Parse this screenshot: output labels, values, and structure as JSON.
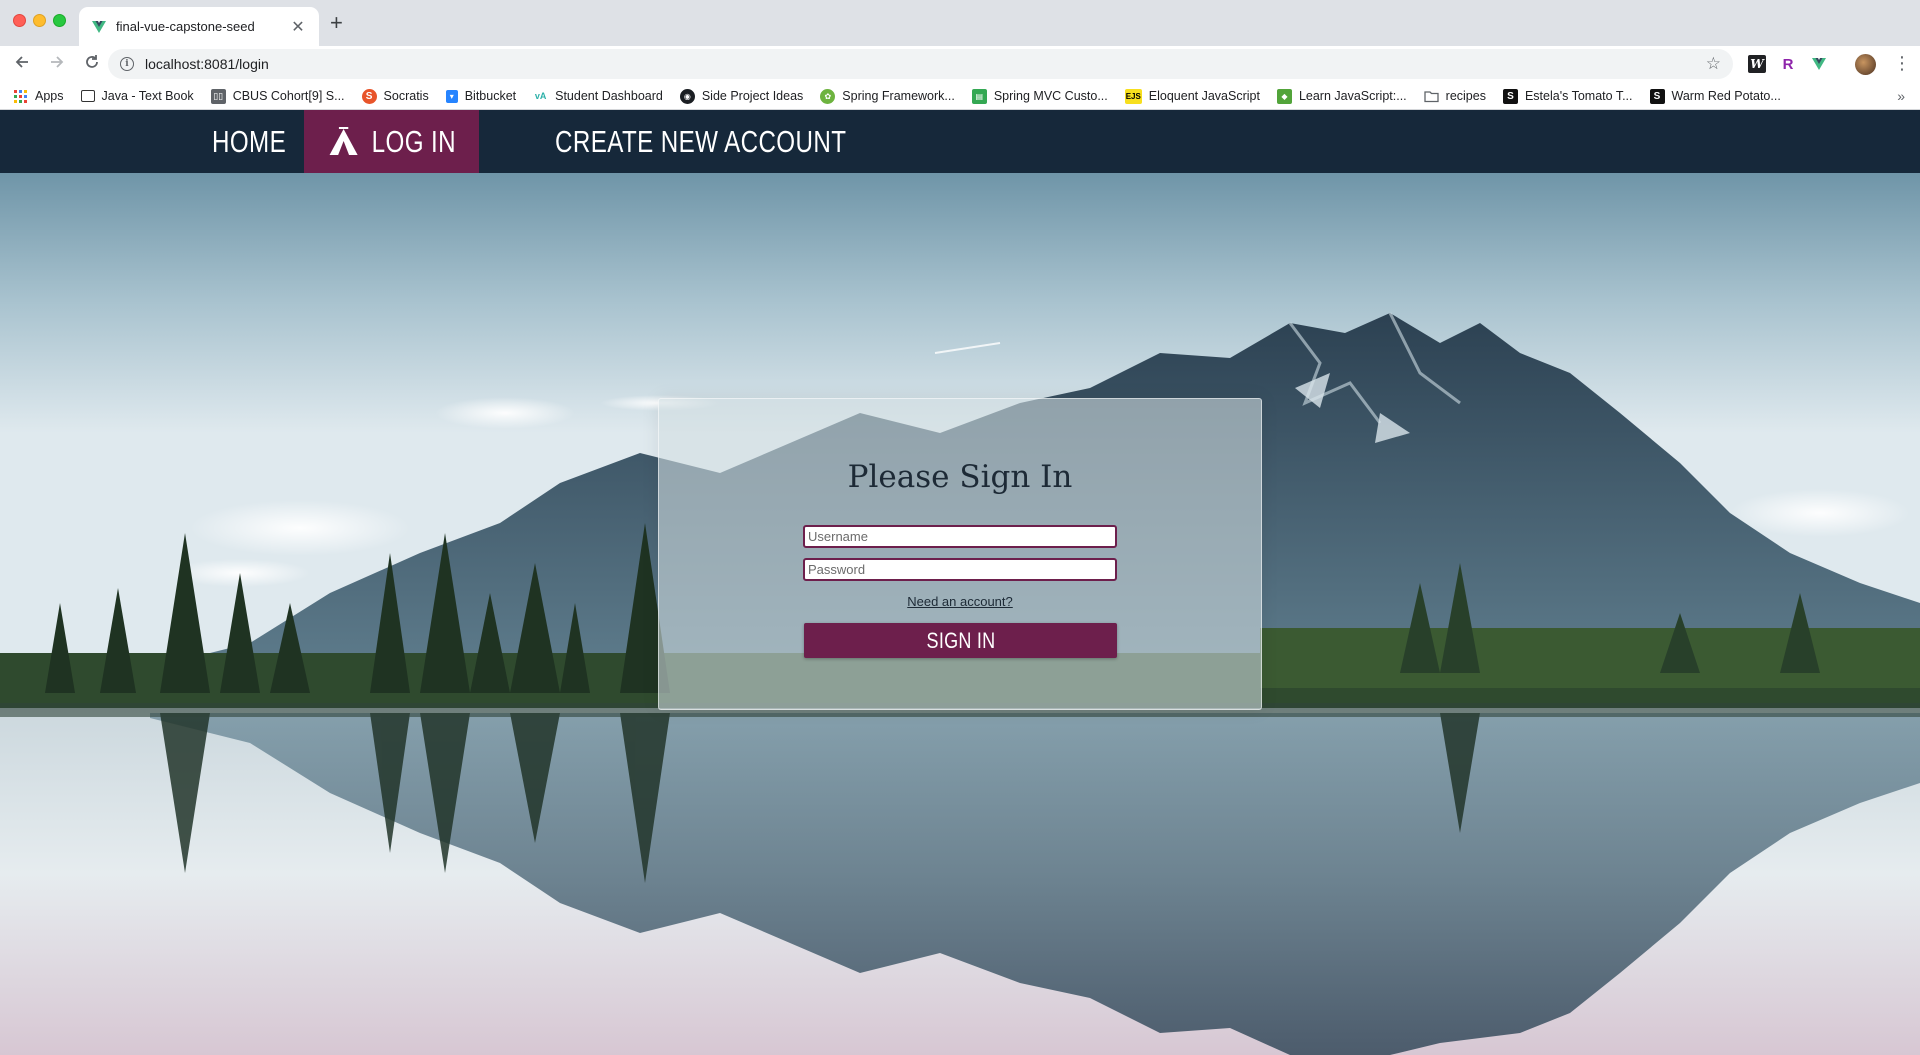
{
  "browser": {
    "tab_title": "final-vue-capstone-seed",
    "tab_close": "✕",
    "new_tab": "+",
    "url": "localhost:8081/login",
    "info_glyph": "i",
    "bookmarks": [
      {
        "label": "Apps",
        "icon": "apps-grid-icon"
      },
      {
        "label": "Java - Text Book",
        "icon": "book-icon"
      },
      {
        "label": "CBUS Cohort[9] S...",
        "icon": "trello-icon"
      },
      {
        "label": "Socratis",
        "icon": "socratis-icon"
      },
      {
        "label": "Bitbucket",
        "icon": "bitbucket-icon"
      },
      {
        "label": "Student Dashboard",
        "icon": "techelevator-icon"
      },
      {
        "label": "Side Project Ideas",
        "icon": "github-icon"
      },
      {
        "label": "Spring Framework...",
        "icon": "spring-icon"
      },
      {
        "label": "Spring MVC Custo...",
        "icon": "sheet-icon"
      },
      {
        "label": "Eloquent JavaScript",
        "icon": "ejs-icon"
      },
      {
        "label": "Learn JavaScript:...",
        "icon": "learn-js-icon"
      },
      {
        "label": "recipes",
        "icon": "folder-icon"
      },
      {
        "label": "Estela's Tomato T...",
        "icon": "squarespace-icon"
      },
      {
        "label": "Warm Red Potato...",
        "icon": "squarespace-icon"
      }
    ],
    "bookmarks_more": "»",
    "icon_colors": {
      "vue_green": "#41b883",
      "vue_dark": "#35495e"
    }
  },
  "navbar": {
    "home": "HOME",
    "login": "LOG IN",
    "create": "CREATE NEW ACCOUNT",
    "bg_color": "#16283a",
    "active_color": "#6d1f4c"
  },
  "login_form": {
    "title": "Please Sign In",
    "username_placeholder": "Username",
    "password_placeholder": "Password",
    "need_account": "Need an account?",
    "submit": "SIGN IN"
  },
  "background": {
    "scene": "mountain-lake-reflection-image"
  }
}
